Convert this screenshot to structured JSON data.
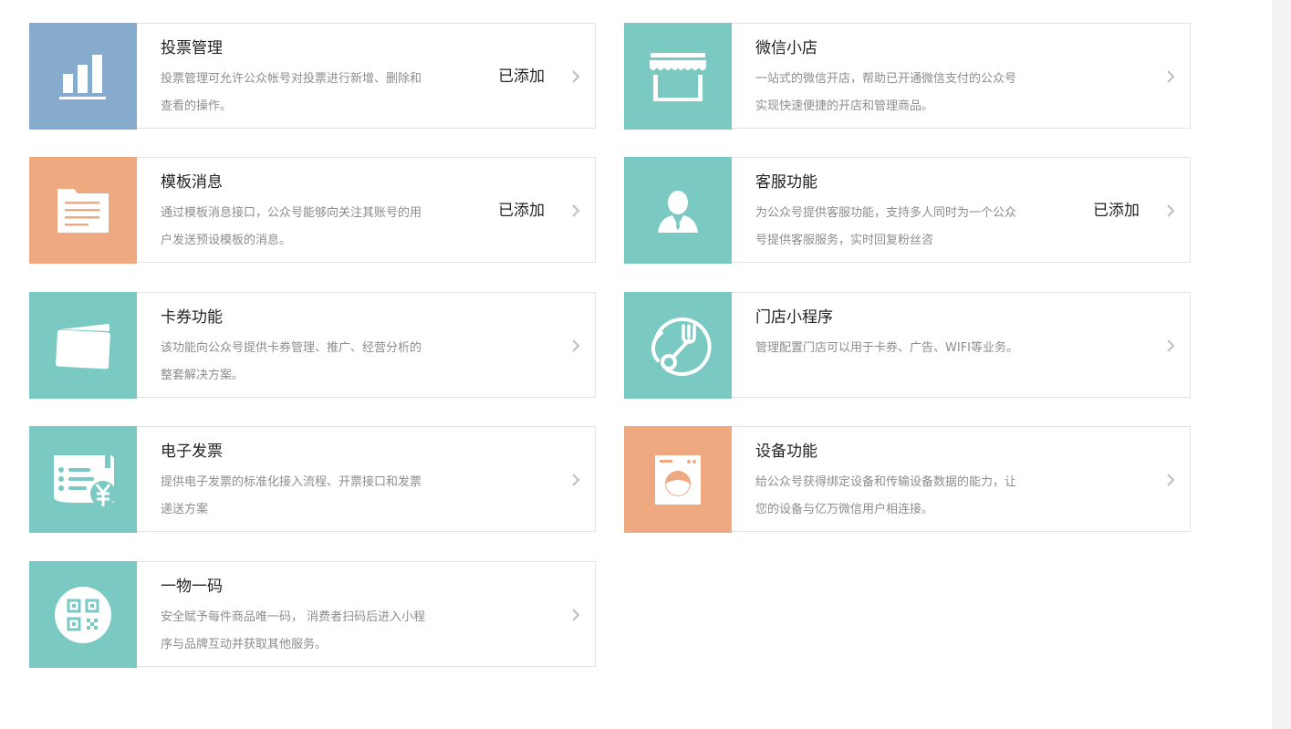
{
  "plugins": [
    {
      "title": "投票管理",
      "desc": "投票管理可允许公众帐号对投票进行新增、删除和查看的操作。",
      "status": "已添加",
      "icon": "bar-chart-icon",
      "color": "#86abcd"
    },
    {
      "title": "微信小店",
      "desc": "一站式的微信开店，帮助已开通微信支付的公众号实现快速便捷的开店和管理商品。",
      "status": "",
      "icon": "storefront-icon",
      "color": "#7bc9c3"
    },
    {
      "title": "模板消息",
      "desc": "通过模板消息接口，公众号能够向关注其账号的用户发送预设模板的消息。",
      "status": "已添加",
      "icon": "document-icon",
      "color": "#eea980"
    },
    {
      "title": "客服功能",
      "desc": "为公众号提供客服功能，支持多人同时为一个公众号提供客服服务，实时回复粉丝咨",
      "status": "已添加",
      "icon": "agent-icon",
      "color": "#7bc9c3"
    },
    {
      "title": "卡券功能",
      "desc": "该功能向公众号提供卡券管理、推广、经营分析的整套解决方案。",
      "status": "",
      "icon": "card-icon",
      "color": "#7bc9c3"
    },
    {
      "title": "门店小程序",
      "desc": "管理配置门店可以用于卡券、广告、WIFI等业务。",
      "status": "",
      "icon": "location-fork-icon",
      "color": "#7bc9c3"
    },
    {
      "title": "电子发票",
      "desc": "提供电子发票的标准化接入流程、开票接口和发票递送方案",
      "status": "",
      "icon": "invoice-icon",
      "color": "#7bc9c3"
    },
    {
      "title": "设备功能",
      "desc": "给公众号获得绑定设备和传输设备数据的能力，让您的设备与亿万微信用户相连接。",
      "status": "",
      "icon": "washing-machine-icon",
      "color": "#eea980"
    },
    {
      "title": "一物一码",
      "desc": "安全赋予每件商品唯一码， 消费者扫码后进入小程序与品牌互动并获取其他服务。",
      "status": "",
      "icon": "qr-code-icon",
      "color": "#7bc9c3"
    }
  ]
}
